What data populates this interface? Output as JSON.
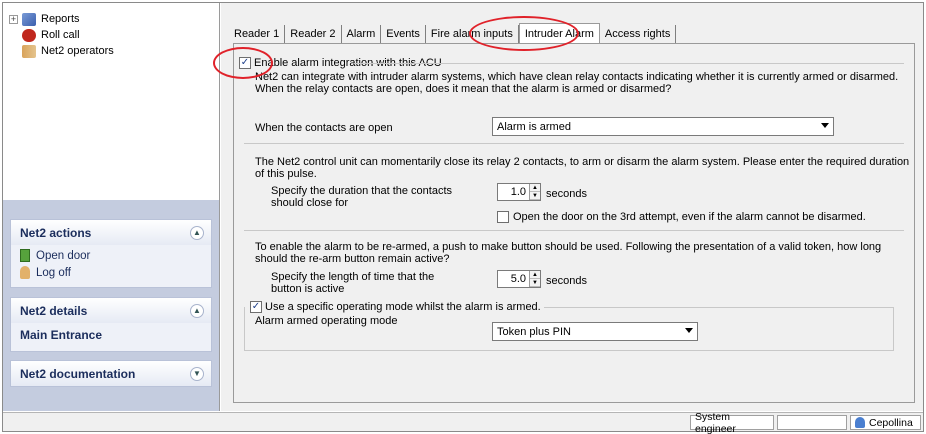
{
  "tree": {
    "items": [
      {
        "label": "Reports",
        "expander": "+"
      },
      {
        "label": "Roll call"
      },
      {
        "label": "Net2 operators"
      }
    ]
  },
  "panels": {
    "actions": {
      "title": "Net2 actions",
      "links": [
        "Open door",
        "Log off"
      ]
    },
    "details": {
      "title": "Net2 details",
      "value": "Main Entrance"
    },
    "documentation": {
      "title": "Net2 documentation"
    }
  },
  "tabs": [
    "Reader 1",
    "Reader 2",
    "Alarm",
    "Events",
    "Fire alarm inputs",
    "Intruder Alarm",
    "Access rights"
  ],
  "active_tab": "Intruder Alarm",
  "form": {
    "enable_label": "Enable alarm integration with this ACU",
    "enable_checked": true,
    "intro_text": "Net2 can integrate with intruder alarm systems, which have clean relay contacts indicating whether it is currently armed or disarmed.  When the relay contacts are open, does it mean that the alarm is armed or disarmed?",
    "contacts_open_label": "When the contacts are open",
    "contacts_open_value": "Alarm is armed",
    "pulse_text": "The Net2 control unit can momentarily close its relay 2 contacts, to arm or disarm the alarm system.  Please enter the required duration of this pulse.",
    "duration_label": "Specify the duration that the contacts should close for",
    "duration_value": "1.0",
    "duration_unit": "seconds",
    "open_door_label": "Open the door on the 3rd attempt, even if the alarm cannot be disarmed.",
    "open_door_checked": false,
    "rearm_text": "To enable the alarm to be re-armed, a push to make button should be used.  Following the presentation of a valid token, how long should the re-arm button remain active?",
    "active_label": "Specify the length of time that the button is active",
    "active_value": "5.0",
    "active_unit": "seconds",
    "mode_enable_label": "Use a specific operating mode whilst the alarm is armed.",
    "mode_enable_checked": true,
    "mode_label": "Alarm armed operating mode",
    "mode_value": "Token plus PIN"
  },
  "statusbar": {
    "user": "System engineer",
    "site": "Cepollina"
  },
  "colors": {
    "highlight_ring": "#e0222a",
    "panel_text": "#1b2d5c",
    "side_background": "#c4ccdf"
  },
  "icons": [
    "reports-icon",
    "roll-call-icon",
    "operators-icon",
    "door-icon",
    "log-off-icon",
    "user-icon"
  ]
}
